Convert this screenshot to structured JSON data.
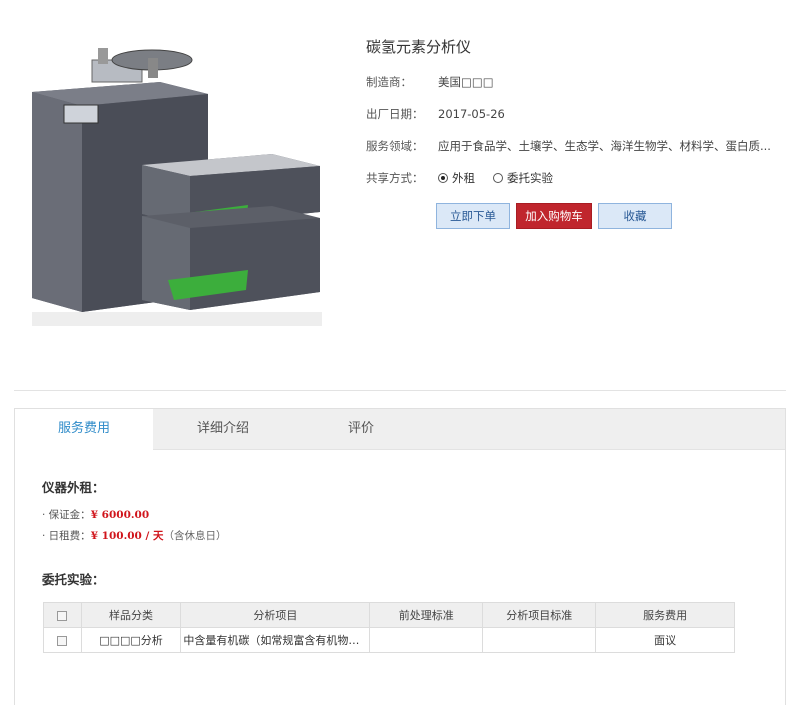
{
  "product": {
    "title": "碳氢元素分析仪",
    "manufacturer_label": "制造商：",
    "manufacturer_value": "美国□□□",
    "date_label": "出厂日期：",
    "date_value": "2017-05-26",
    "domain_label": "服务领域：",
    "domain_value": "应用于食品学、土壤学、生态学、海洋生物学、材料学、蛋白质...",
    "share_label": "共享方式：",
    "share_options": [
      "外租",
      "委托实验"
    ],
    "share_selected": "外租"
  },
  "actions": {
    "order_label": "立即下单",
    "cart_label": "加入购物车",
    "favorite_label": "收藏"
  },
  "tabs": [
    {
      "label": "服务费用",
      "active": true
    },
    {
      "label": "详细介绍",
      "active": false
    },
    {
      "label": "评价",
      "active": false
    }
  ],
  "rental": {
    "title": "仪器外租：",
    "deposit_label": "· 保证金：",
    "deposit_value": "¥ 6000.00",
    "daily_label": "· 日租费：",
    "daily_value": "¥ 100.00 / 天",
    "daily_note": "（含休息日）"
  },
  "commission": {
    "title": "委托实验：",
    "columns": [
      "样品分类",
      "分析项目",
      "前处理标准",
      "分析项目标准",
      "服务费用"
    ],
    "rows": [
      {
        "category": "□□□□分析",
        "item": "中含量有机碳（如常规富含有机物的土壤...",
        "pretreatment": "",
        "standard": "",
        "fee": "面议"
      }
    ]
  },
  "colors": {
    "accent_blue": "#2e8bc9",
    "cart_red": "#c0262d",
    "price_red": "#d0141b"
  }
}
